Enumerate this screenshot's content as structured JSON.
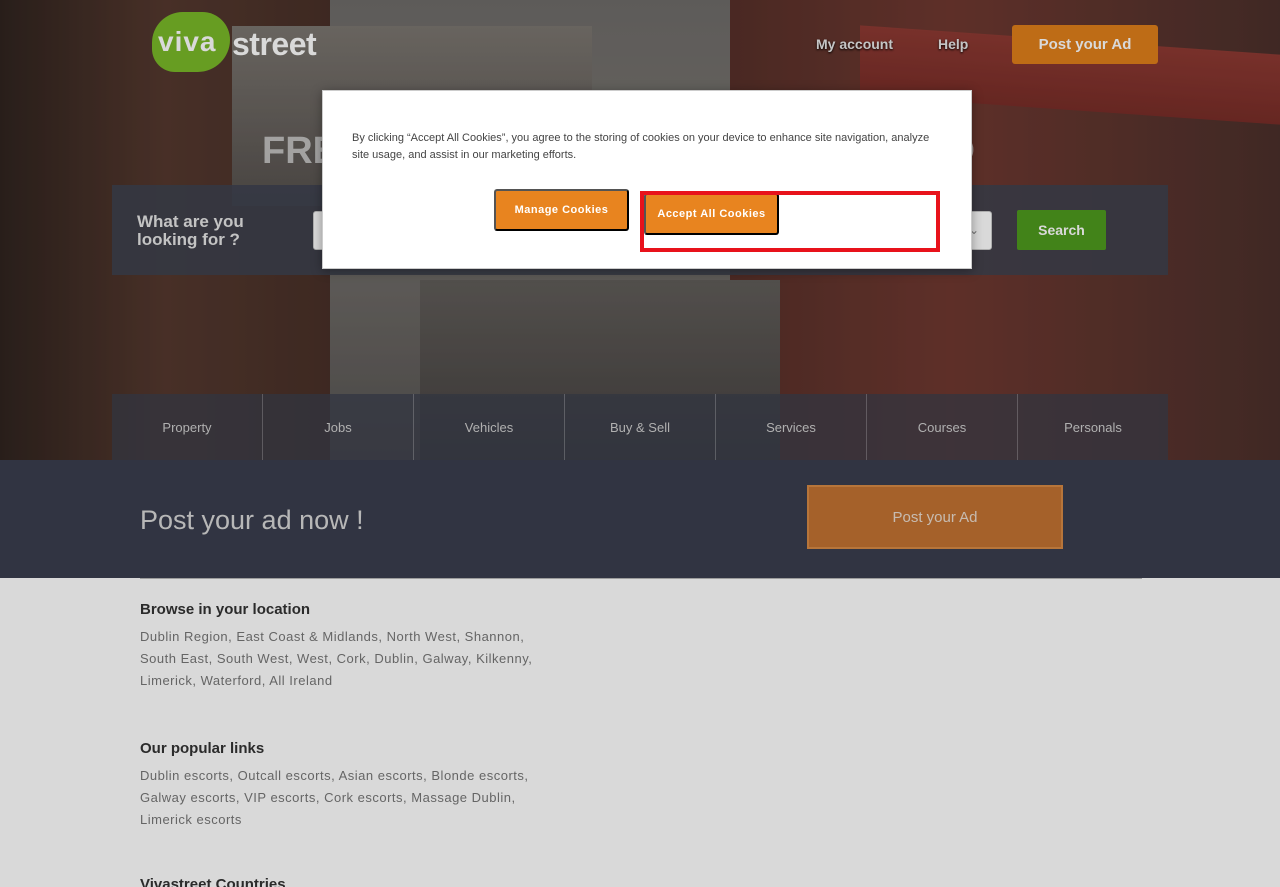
{
  "header": {
    "logo_viva": "viva",
    "logo_street": "street",
    "my_account": "My account",
    "help": "Help",
    "post_ad": "Post your Ad"
  },
  "hero": {
    "title_left": "FRE",
    "title_right": "ND",
    "search_label": "What are you looking for ?",
    "search_input_placeholder": "",
    "search_select_value": "",
    "search_button": "Search"
  },
  "categories": [
    "Property",
    "Jobs",
    "Vehicles",
    "Buy & Sell",
    "Services",
    "Courses",
    "Personals"
  ],
  "post_band": {
    "heading": "Post your ad now !",
    "button": "Post your Ad"
  },
  "browse": {
    "title": "Browse in your location",
    "links": [
      "Dublin Region",
      "East Coast & Midlands",
      "North West",
      "Shannon",
      "South East",
      "South West",
      "West",
      "Cork",
      "Dublin",
      "Galway",
      "Kilkenny",
      "Limerick",
      "Waterford",
      "All Ireland"
    ]
  },
  "popular": {
    "title": "Our popular links",
    "links": [
      "Dublin escorts",
      "Outcall escorts",
      "Asian escorts",
      "Blonde escorts",
      "Galway escorts",
      "VIP escorts",
      "Cork escorts",
      "Massage Dublin",
      "Limerick escorts"
    ]
  },
  "countries": {
    "title": "Vivastreet Countries"
  },
  "cookie": {
    "text": "By clicking “Accept All Cookies”, you agree to the storing of cookies on your device to enhance site navigation, analyze site usage, and assist in our marketing efforts.",
    "manage": "Manage Cookies",
    "accept": "Accept All Cookies"
  },
  "colors": {
    "accent_orange": "#e8841f",
    "brand_green": "#7ab929",
    "highlight_red": "#e8121b"
  }
}
